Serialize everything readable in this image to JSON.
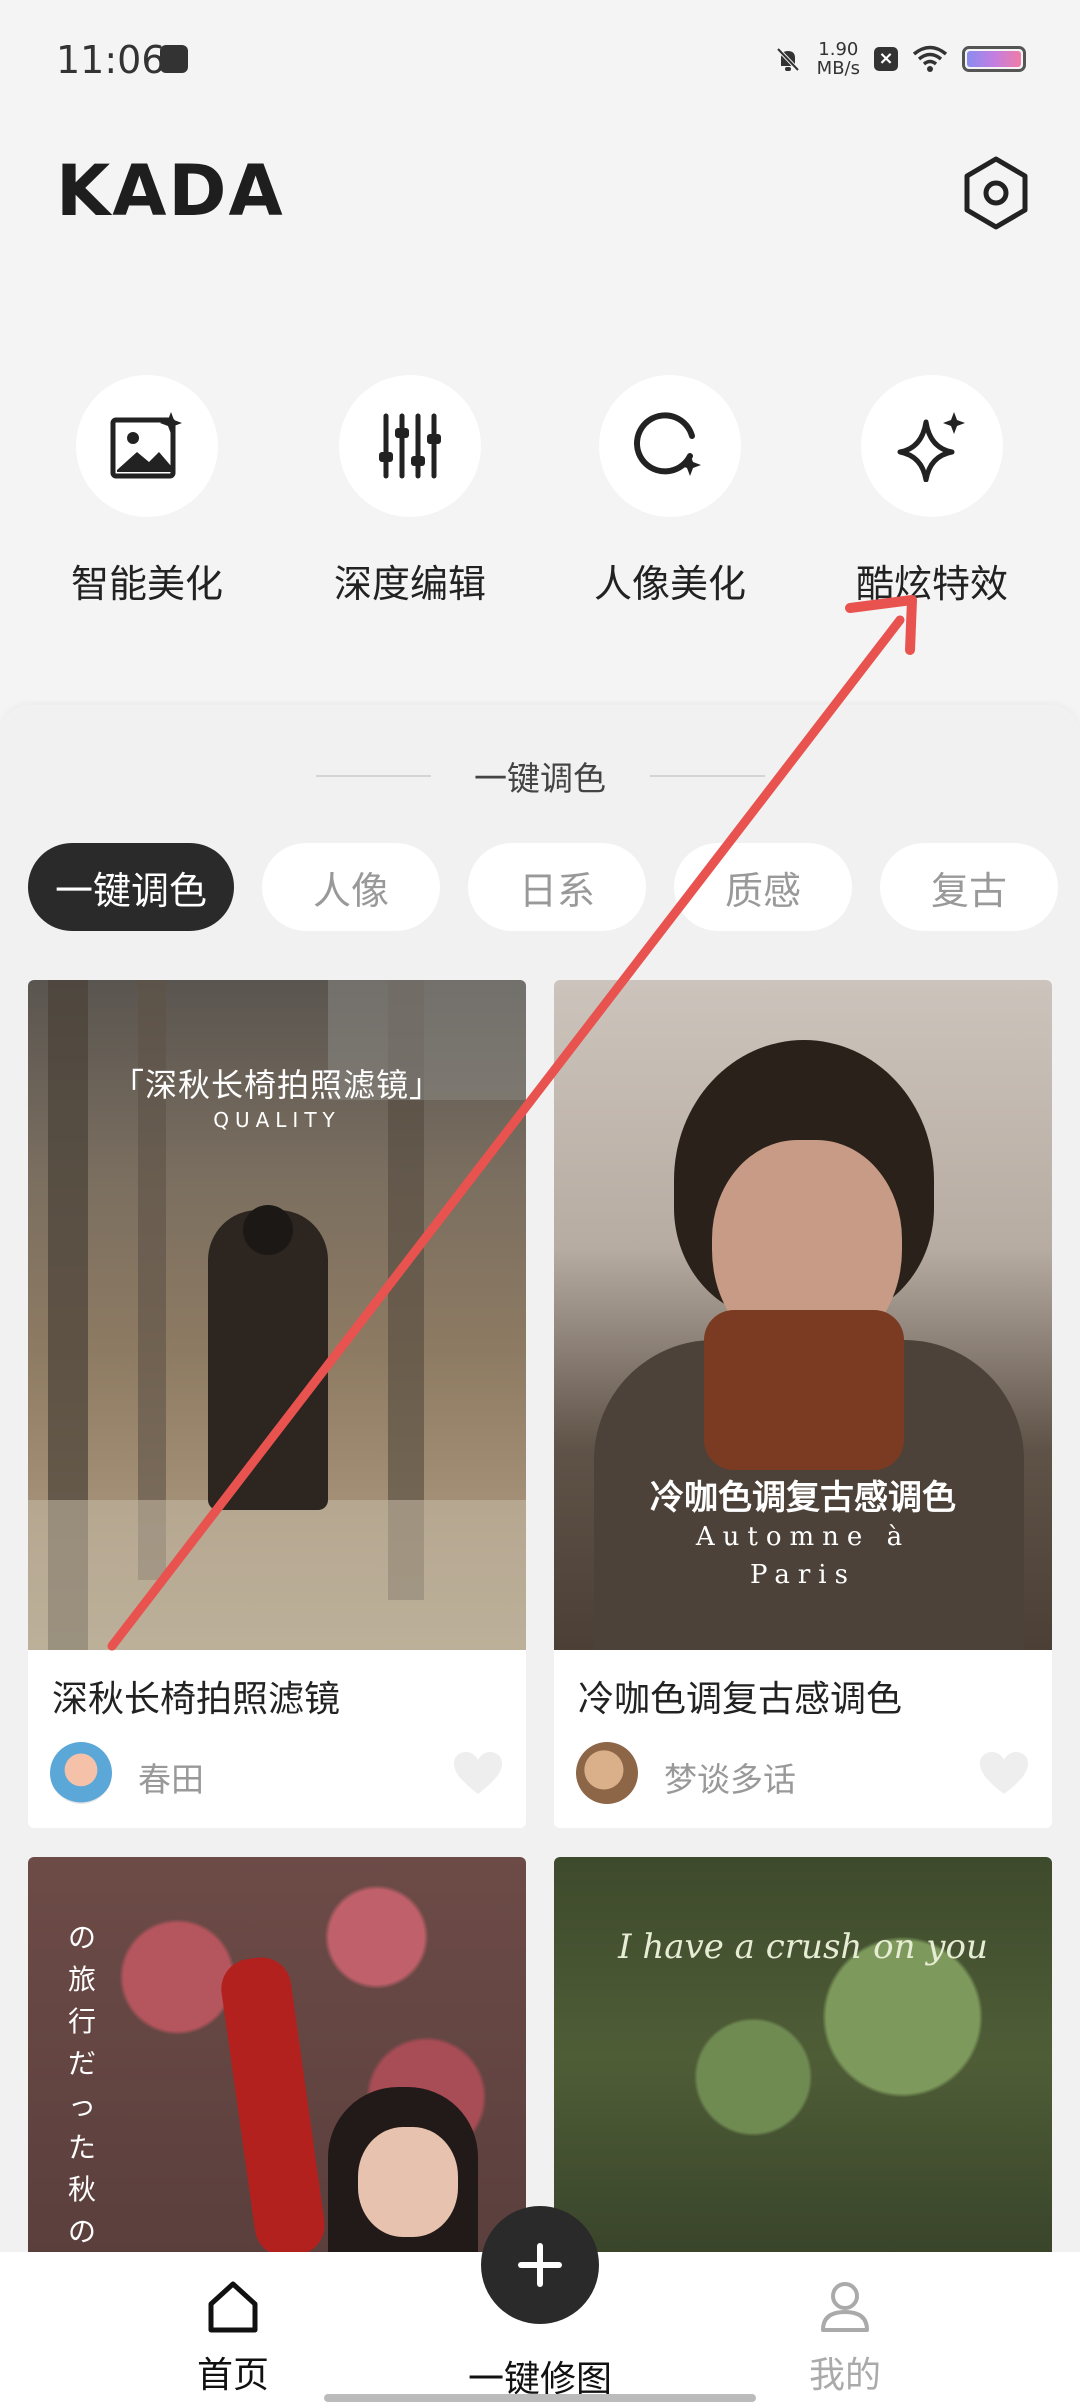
{
  "status_bar": {
    "time": "11:06",
    "speed_value": "1.90",
    "speed_unit": "MB/s"
  },
  "header": {
    "logo": "KADA",
    "settings_icon": "hexagon-settings-icon"
  },
  "tools": [
    {
      "label": "智能美化",
      "icon": "image-sparkle-icon"
    },
    {
      "label": "深度编辑",
      "icon": "sliders-icon"
    },
    {
      "label": "人像美化",
      "icon": "circle-sparkle-icon"
    },
    {
      "label": "酷炫特效",
      "icon": "sparkle-star-icon"
    }
  ],
  "section": {
    "title": "一键调色"
  },
  "chips": [
    {
      "label": "一键调色",
      "active": true
    },
    {
      "label": "人像",
      "active": false
    },
    {
      "label": "日系",
      "active": false
    },
    {
      "label": "质感",
      "active": false
    },
    {
      "label": "复古",
      "active": false
    }
  ],
  "cards": [
    {
      "title": "深秋长椅拍照滤镜",
      "author": "春田",
      "overlay_title": "「深秋长椅拍照滤镜」",
      "overlay_sub": "QUALITY"
    },
    {
      "title": "冷咖色调复古感调色",
      "author": "梦谈多话",
      "overlay_title": "冷咖色调复古感调色",
      "overlay_sub1": "Automne à",
      "overlay_sub2": "Paris"
    },
    {
      "overlay_title": "の旅行だった秋の日わり"
    },
    {
      "overlay_title": "I have a crush on you"
    }
  ],
  "bottom_nav": {
    "home": "首页",
    "edit": "一键修图",
    "mine": "我的"
  },
  "colors": {
    "accent_dark": "#2a2a2a",
    "arrow": "#e8534f",
    "background": "#f4f4f4"
  }
}
